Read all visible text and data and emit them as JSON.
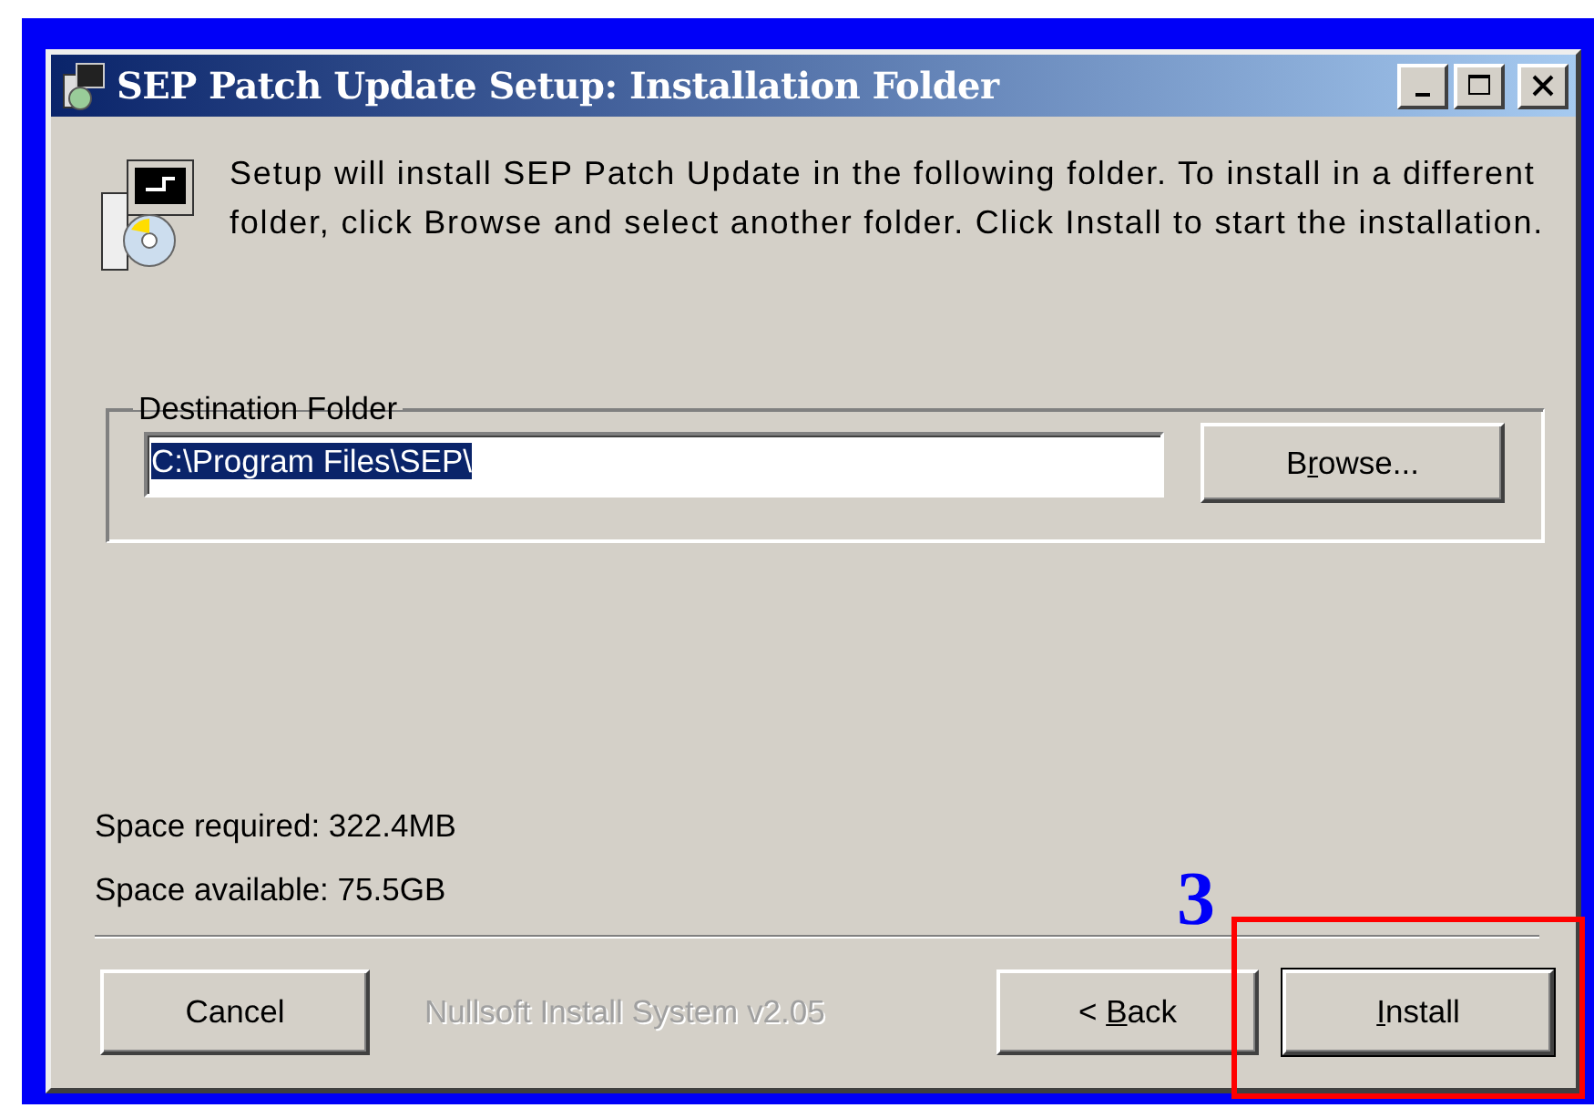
{
  "window": {
    "title": "SEP Patch Update Setup: Installation Folder"
  },
  "intro": "Setup will install SEP Patch Update in the following folder. To install in a different folder, click Browse and select another folder. Click Install to start the installation.",
  "destination": {
    "legend": "Destination Folder",
    "value": "C:\\Program Files\\SEP\\",
    "selected": true,
    "browse": {
      "before": "B",
      "key": "r",
      "after": "owse..."
    }
  },
  "space_required": "Space required: 322.4MB",
  "space_available": "Space available: 75.5GB",
  "branding": "Nullsoft Install System v2.05",
  "buttons": [
    {
      "kind": "cancel",
      "before": "Cancel",
      "default": false
    },
    {
      "kind": "back",
      "before": "< ",
      "key": "B",
      "after": "ack",
      "default": false
    },
    {
      "kind": "install",
      "key": "I",
      "after": "nstall",
      "default": true
    }
  ],
  "annotation": {
    "step": "3"
  }
}
